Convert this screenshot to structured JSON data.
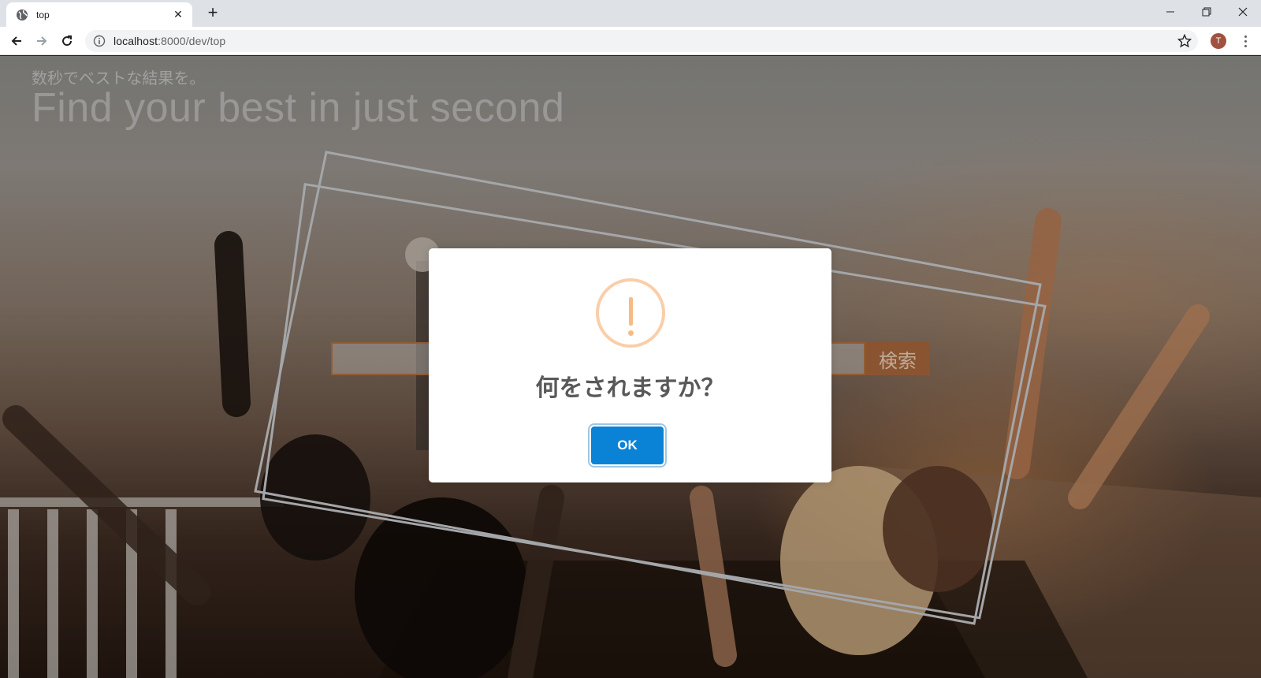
{
  "browser": {
    "tab_title": "top",
    "url_host": "localhost",
    "url_path": ":8000/dev/top",
    "profile_initial": "T"
  },
  "page": {
    "tagline_ja": "数秒でベストな結果を。",
    "headline": "Find your best in just second",
    "search_button_label": "検索"
  },
  "dialog": {
    "message": "何をされますか？",
    "ok_label": "OK",
    "icon": "warning-icon",
    "icon_color": "#f8bb86",
    "button_color": "#0a83d6"
  }
}
